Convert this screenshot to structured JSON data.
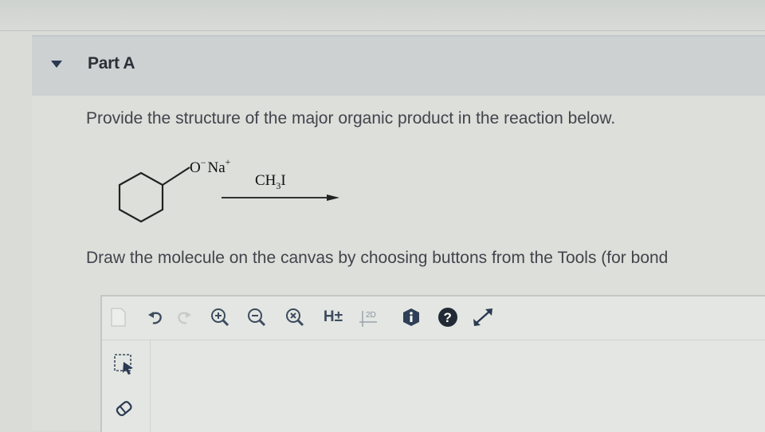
{
  "part": {
    "title": "Part A"
  },
  "question": {
    "prompt": "Provide the structure of the major organic product in the reaction below.",
    "instruction": "Draw the molecule on the canvas by choosing buttons from the Tools (for bond"
  },
  "reaction": {
    "reactant_charge_label": "O",
    "reactant_counterion": "Na",
    "superscript_minus": "−",
    "superscript_plus": "+",
    "reagent": {
      "prefix": "CH",
      "subscript": "3",
      "suffix": "I"
    }
  },
  "toolbar": {
    "items": [
      {
        "name": "document-icon"
      },
      {
        "name": "undo-icon"
      },
      {
        "name": "redo-icon"
      },
      {
        "name": "zoom-in-icon"
      },
      {
        "name": "zoom-out-icon"
      },
      {
        "name": "zoom-reset-icon"
      },
      {
        "name": "hydrogen-toggle-icon"
      },
      {
        "name": "2d-clean-icon"
      },
      {
        "name": "info-icon"
      },
      {
        "name": "help-icon"
      },
      {
        "name": "fullscreen-icon"
      }
    ],
    "hydrogen_label": "H±",
    "clean_label": "2D"
  },
  "sidebar": {
    "items": [
      {
        "name": "selection-tool-icon"
      },
      {
        "name": "eraser-tool-icon"
      }
    ]
  },
  "colors": {
    "accent_dark": "#2b3a52",
    "text": "#41454c",
    "icon": "#3d4b5e"
  }
}
